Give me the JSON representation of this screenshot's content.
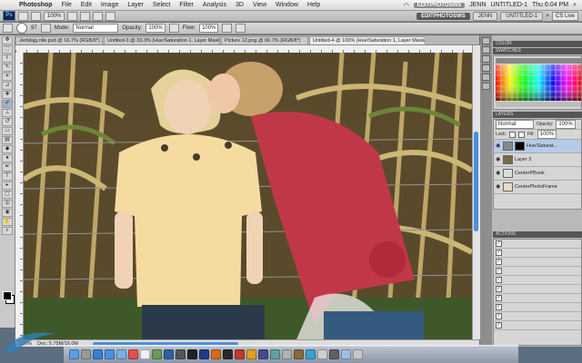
{
  "menubar": {
    "app": "Photoshop",
    "items": [
      "File",
      "Edit",
      "Image",
      "Layer",
      "Select",
      "Filter",
      "Analysis",
      "3D",
      "View",
      "Window",
      "Help"
    ],
    "right_badge": "EDITPHOTOSWS",
    "user": "JENN",
    "doc": "UNTITLED-1",
    "clock": "Thu 6:04 PM"
  },
  "appbar": {
    "logo": "Ps",
    "zoom": "100%",
    "cs_live": "CS Live"
  },
  "optbar": {
    "brush_size": "97",
    "mode_label": "Mode:",
    "mode_value": "Normal",
    "opacity_label": "Opacity:",
    "opacity_value": "100%",
    "flow_label": "Flow:",
    "flow_value": "100%"
  },
  "document": {
    "tabs": [
      "Jerbilsjg.nile.psd @ 16.7% (RGB/8*)",
      "Untitled-3 @ 33.3% (Hue/Saturation 1, Layer Mask/8)",
      "Picture 12.png @ 66.7% (RGB/8*)",
      "Untitled-4 @ 100% (Hue/Saturation 1, Layer Mask/8)"
    ],
    "title": "Untitled-4 @ 100% (Hue/Saturation 1, Layer Mask/8) *",
    "status_zoom": "100%",
    "status_doc": "Doc: 5.75M/16.0M"
  },
  "panels": {
    "color_tab": "COLOR",
    "swatches_tab": "SWATCHES",
    "layers_tab": "LAYERS",
    "blend_mode": "Normal",
    "opacity": "100%",
    "fill": "100%",
    "layers": [
      {
        "name": "Hue/Saturat...",
        "selected": true
      },
      {
        "name": "Layer 3",
        "selected": false
      },
      {
        "name": "CenterPBook",
        "selected": false
      },
      {
        "name": "CenterPhotoFrame",
        "selected": false
      }
    ],
    "actions_tab": "ACTIONS"
  },
  "colors": {
    "accent": "#4a8fde",
    "selected_layer": "#b6cbe7"
  }
}
